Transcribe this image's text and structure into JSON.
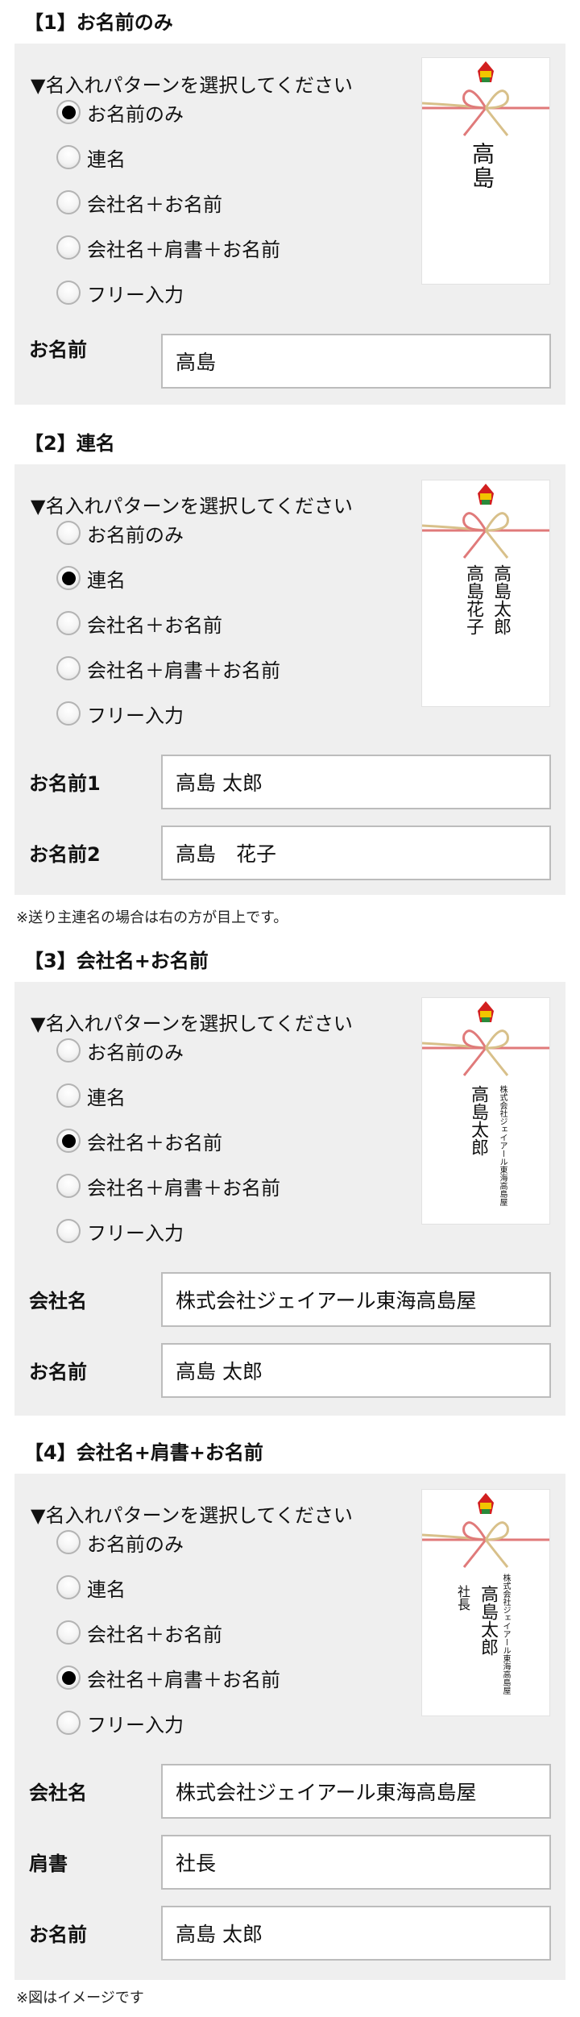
{
  "pattern_prompt": "▼名入れパターンを選択してください",
  "radio_options": [
    "お名前のみ",
    "連名",
    "会社名＋お名前",
    "会社名＋肩書＋お名前",
    "フリー入力"
  ],
  "section1": {
    "title": "【1】お名前のみ",
    "label_name": "お名前",
    "value_name": "高島",
    "preview_name": "高島"
  },
  "section2": {
    "title": "【2】連名",
    "label_name1": "お名前1",
    "value_name1": "高島 太郎",
    "label_name2": "お名前2",
    "value_name2": "高島　花子",
    "preview_name1": "高島太郎",
    "preview_name2": "高島花子",
    "note": "※送り主連名の場合は右の方が目上です。"
  },
  "section3": {
    "title": "【3】会社名+お名前",
    "label_company": "会社名",
    "value_company": "株式会社ジェイアール東海高島屋",
    "label_name": "お名前",
    "value_name": "高島 太郎",
    "preview_company": "株式会社ジェイアール東海高島屋",
    "preview_name": "高島太郎"
  },
  "section4": {
    "title": "【4】会社名+肩書+お名前",
    "label_company": "会社名",
    "value_company": "株式会社ジェイアール東海高島屋",
    "label_title": "肩書",
    "value_title": "社長",
    "label_name": "お名前",
    "value_name": "高島 太郎",
    "preview_company": "株式会社ジェイアール東海高島屋",
    "preview_title": "社長",
    "preview_name": "高島太郎",
    "note": "※図はイメージです"
  },
  "colors": {
    "panel_bg": "#efefef",
    "ribbon_red": "#e07a7a",
    "ribbon_gold": "#d8c08a",
    "noshi_red": "#d21f1f",
    "noshi_yellow": "#f2c500",
    "noshi_green": "#2a8a3a"
  }
}
